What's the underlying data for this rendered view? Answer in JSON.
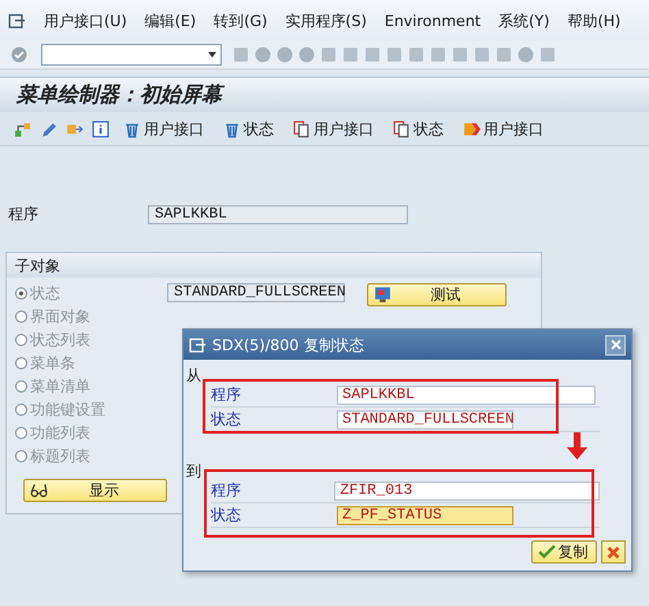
{
  "menu": [
    {
      "label": "用户接口(U)"
    },
    {
      "label": "编辑(E)"
    },
    {
      "label": "转到(G)"
    },
    {
      "label": "实用程序(S)"
    },
    {
      "label": "Environment"
    },
    {
      "label": "系统(Y)"
    },
    {
      "label": "帮助(H)"
    }
  ],
  "title": "菜单绘制器：初始屏幕",
  "app_toolbar": [
    {
      "kind": "delete",
      "label": "用户接口"
    },
    {
      "kind": "delete",
      "label": "状态"
    },
    {
      "kind": "copy",
      "label": "用户接口"
    },
    {
      "kind": "copy",
      "label": "状态"
    },
    {
      "kind": "transfer",
      "label": "用户接口"
    }
  ],
  "program": {
    "label": "程序",
    "value": "SAPLKKBL"
  },
  "subobjects": {
    "title": "子对象",
    "status_value": "STANDARD_FULLSCREEN",
    "test_button": "测试",
    "display_button": "显示",
    "items": [
      {
        "label": "状态",
        "selected": true,
        "disabled": true
      },
      {
        "label": "界面对象",
        "selected": false,
        "disabled": true
      },
      {
        "label": "状态列表",
        "selected": false,
        "disabled": true
      },
      {
        "label": "菜单条",
        "selected": false,
        "disabled": true
      },
      {
        "label": "菜单清单",
        "selected": false,
        "disabled": true
      },
      {
        "label": "功能键设置",
        "selected": false,
        "disabled": true
      },
      {
        "label": "功能列表",
        "selected": false,
        "disabled": true
      },
      {
        "label": "标题列表",
        "selected": false,
        "disabled": true
      }
    ]
  },
  "dialog": {
    "title": "SDX(5)/800 复制状态",
    "copy_button": "复制",
    "sections": [
      {
        "label": "从",
        "fields": [
          {
            "label": "程序",
            "value": "SAPLKKBL",
            "focused": false
          },
          {
            "label": "状态",
            "value": "STANDARD_FULLSCREEN",
            "focused": false
          }
        ]
      },
      {
        "label": "到",
        "fields": [
          {
            "label": "程序",
            "value": "ZFIR_013",
            "focused": false
          },
          {
            "label": "状态",
            "value": "Z_PF_STATUS",
            "focused": true
          }
        ]
      }
    ]
  }
}
